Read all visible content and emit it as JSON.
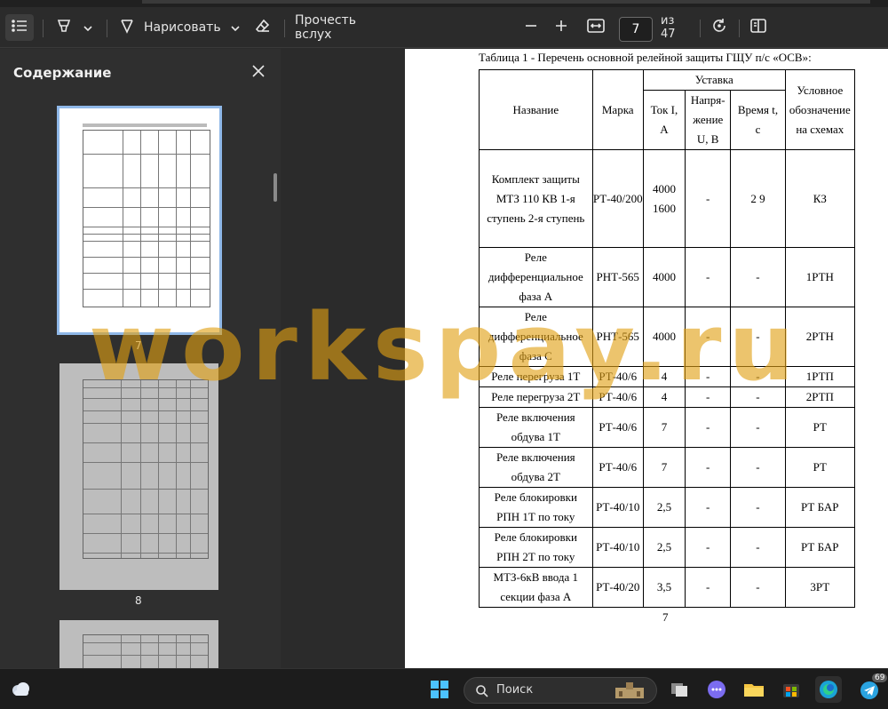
{
  "toolbar": {
    "draw_label": "Нарисовать",
    "read_aloud_label": "Прочесть вслух",
    "page_current": "7",
    "page_total": "из 47"
  },
  "sidebar": {
    "title": "Содержание",
    "thumbnails": [
      {
        "number": "7"
      },
      {
        "number": "8"
      }
    ]
  },
  "document": {
    "caption": "Таблица 1 - Перечень основной релейной защиты ГЩУ п/с «ОСВ»:",
    "headers": {
      "name": "Название",
      "mark": "Марка",
      "setting": "Уставка",
      "current": "Ток I, А",
      "voltage": "Напря-жение U, В",
      "time": "Время t, с",
      "symbol": "Условное обозначение на схемах"
    },
    "rows": [
      {
        "name": "Комплект защиты МТЗ   110 КВ 1-я ступень 2-я ступень",
        "mark": "РТ-40/200",
        "current": "4000 1600",
        "voltage": "-",
        "time": "2 9",
        "symbol": "КЗ"
      },
      {
        "name": "Реле дифференциальное фаза А",
        "mark": "РНТ-565",
        "current": "4000",
        "voltage": "-",
        "time": "-",
        "symbol": "1РТН"
      },
      {
        "name": "Реле дифференциальное фаза С",
        "mark": "РНТ-565",
        "current": "4000",
        "voltage": "-",
        "time": "-",
        "symbol": "2РТН"
      },
      {
        "name": "Реле перегруза 1Т",
        "mark": "РТ-40/6",
        "current": "4",
        "voltage": "-",
        "time": "-",
        "symbol": "1РТП"
      },
      {
        "name": "Реле перегруза 2Т",
        "mark": "РТ-40/6",
        "current": "4",
        "voltage": "-",
        "time": "-",
        "symbol": "2РТП"
      },
      {
        "name": "Реле включения обдува 1Т",
        "mark": "РТ-40/6",
        "current": "7",
        "voltage": "-",
        "time": "-",
        "symbol": "РТ"
      },
      {
        "name": "Реле включения обдува 2Т",
        "mark": "РТ-40/6",
        "current": "7",
        "voltage": "-",
        "time": "-",
        "symbol": "РТ"
      },
      {
        "name": "Реле блокировки РПН 1Т по току",
        "mark": "РТ-40/10",
        "current": "2,5",
        "voltage": "-",
        "time": "-",
        "symbol": "РТ БАР"
      },
      {
        "name": "Реле блокировки РПН 2Т по току",
        "mark": "РТ-40/10",
        "current": "2,5",
        "voltage": "-",
        "time": "-",
        "symbol": "РТ БАР"
      },
      {
        "name": "МТЗ-6кВ ввода 1 секции фаза А",
        "mark": "РТ-40/20",
        "current": "3,5",
        "voltage": "-",
        "time": "-",
        "symbol": "3РТ"
      }
    ],
    "page_number": "7"
  },
  "watermark": "workspay.ru",
  "taskbar": {
    "search_label": "Поиск",
    "telegram_badge": "69"
  }
}
